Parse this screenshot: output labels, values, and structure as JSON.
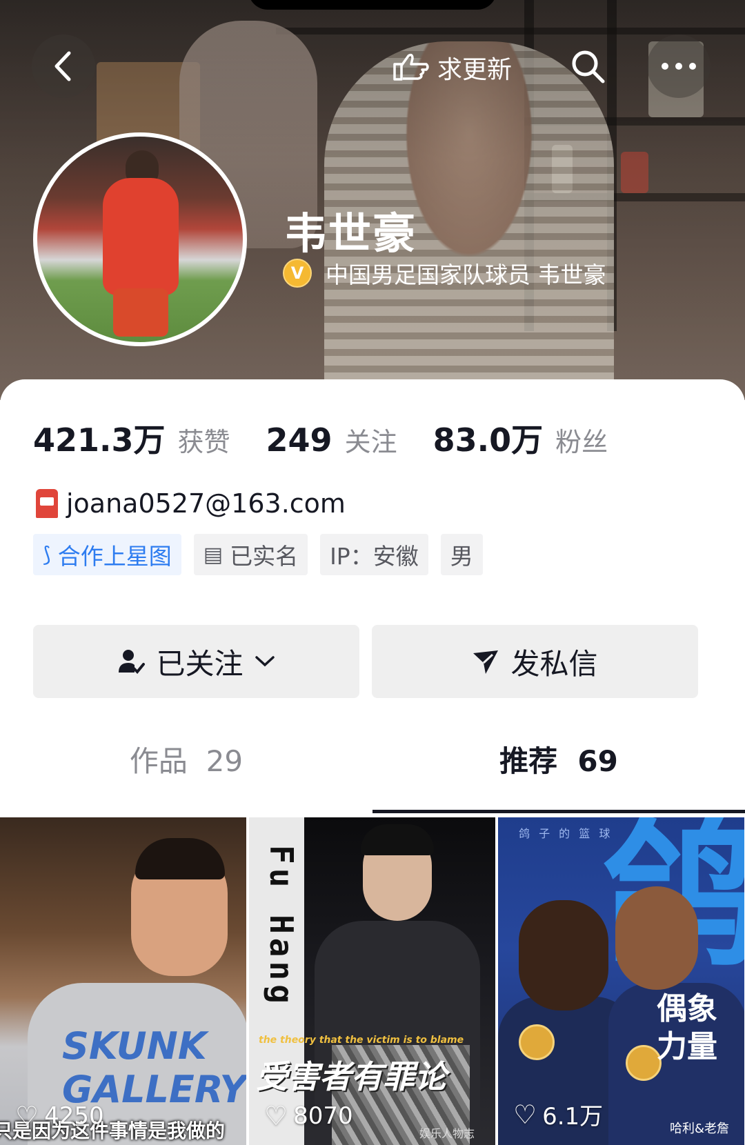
{
  "header": {
    "back_icon": "chevron-left-icon",
    "update_label": "求更新",
    "search_icon": "search-icon",
    "more_icon": "more-horizontal-icon",
    "name": "韦世豪",
    "verify_badge": "V",
    "verify_text": "中国男足国家队球员 韦世豪"
  },
  "stats": [
    {
      "value": "421.3万",
      "label": "获赞"
    },
    {
      "value": "249",
      "label": "关注"
    },
    {
      "value": "83.0万",
      "label": "粉丝"
    }
  ],
  "profile": {
    "email": "joana0527@163.com",
    "tags": [
      "合作上星图",
      "已实名",
      "IP：安徽",
      "男"
    ]
  },
  "actions": {
    "follow_label": "已关注",
    "message_label": "发私信"
  },
  "tabs": {
    "works": "作品",
    "works_count": "29",
    "recommend": "推荐",
    "recommend_count": "69",
    "active": "recommend"
  },
  "videos": [
    {
      "likes": "4250",
      "subtitle": "只是因为这件事情是我做的",
      "shirt_text": "SKUNK GALLERY"
    },
    {
      "likes": "8070",
      "vertical_text": "Fu Hang",
      "caption": "the theory that the victim is to blame",
      "title": "受害者有罪论",
      "footer": "娱乐人物志"
    },
    {
      "likes": "6.1万",
      "big_char": "鸽",
      "top_text": "鸽 子 的 篮 球",
      "vertical_text": "偶象力量",
      "credit": "哈利&老詹"
    }
  ],
  "colors": {
    "accent_blue": "#2d7cf0",
    "verify_gold": "#f5b932",
    "text_primary": "#161823",
    "text_secondary": "#8a8b91"
  }
}
